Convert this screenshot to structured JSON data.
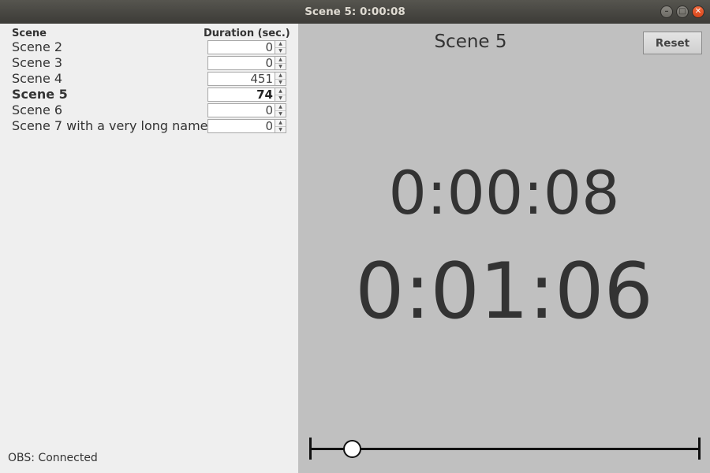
{
  "window": {
    "title": "Scene 5: 0:00:08",
    "controls": [
      "minimize-icon",
      "maximize-icon",
      "close-icon"
    ]
  },
  "scene_table": {
    "header_scene": "Scene",
    "header_duration": "Duration (sec.)",
    "rows": [
      {
        "name": "Scene 2",
        "duration": "0",
        "active": false
      },
      {
        "name": "Scene 3",
        "duration": "0",
        "active": false
      },
      {
        "name": "Scene 4",
        "duration": "451",
        "active": false
      },
      {
        "name": "Scene 5",
        "duration": "74",
        "active": true
      },
      {
        "name": "Scene 6",
        "duration": "0",
        "active": false
      },
      {
        "name": "Scene 7 with a very long name",
        "duration": "0",
        "active": false
      }
    ]
  },
  "status": "OBS: Connected",
  "timer": {
    "scene": "Scene 5",
    "reset_label": "Reset",
    "elapsed": "0:00:08",
    "total": "0:01:06",
    "progress_fraction": 0.108
  },
  "colors": {
    "close_button": "#e95420",
    "right_panel_bg": "#c0c0c0",
    "left_panel_bg": "#efefef"
  }
}
